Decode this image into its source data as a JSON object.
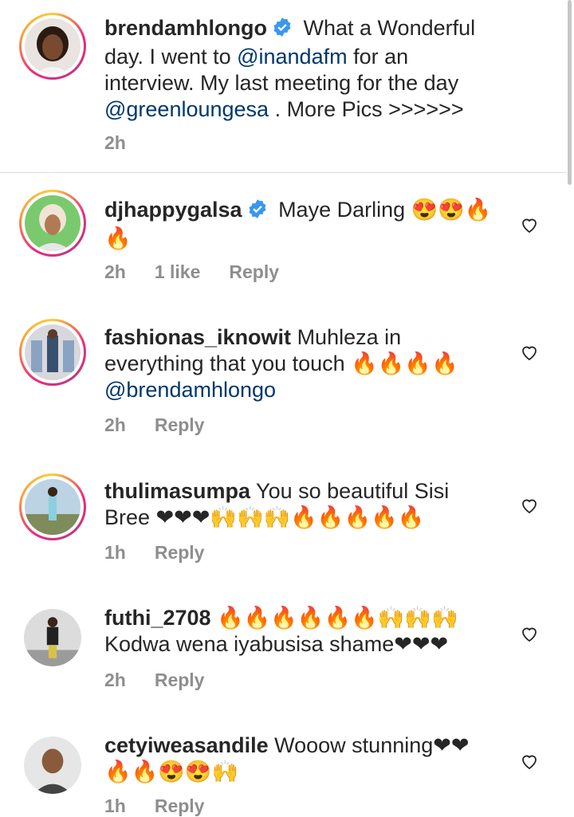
{
  "caption": {
    "username": "brendamhlongo",
    "verified": true,
    "text_start": "What a Wonderful",
    "line2_a": "day. I went to ",
    "mention1": "@inandafm",
    "line2_b": " for an",
    "line3": "interview. My last meeting for the day",
    "mention2": "@greenloungesa",
    "line4_b": " . More Pics >>>>>>",
    "time": "2h"
  },
  "comments": [
    {
      "username": "djhappygalsa",
      "verified": true,
      "line1": "Maye Darling 😍😍🔥",
      "line2": "🔥",
      "time": "2h",
      "likes": "1 like",
      "reply": "Reply"
    },
    {
      "username": "fashionas_iknowit",
      "line1": " Muhleza in",
      "line2": "everything that you touch 🔥🔥🔥🔥",
      "mention": "@brendamhlongo",
      "time": "2h",
      "reply": "Reply"
    },
    {
      "username": "thulimasumpa",
      "line1": " You so beautiful Sisi",
      "line2": "Bree ❤❤❤🙌🙌🙌🔥🔥🔥🔥🔥",
      "time": "1h",
      "reply": "Reply"
    },
    {
      "username": "futhi_2708",
      "line1": " 🔥🔥🔥🔥🔥🔥🙌🙌🙌",
      "line2": "Kodwa wena iyabusisa shame❤❤❤",
      "time": "2h",
      "reply": "Reply"
    },
    {
      "username": "cetyiweasandile",
      "line1": " Wooow stunning❤❤",
      "line2": "🔥🔥😍😍🙌",
      "time": "1h",
      "reply": "Reply"
    }
  ],
  "colors": {
    "text": "#262626",
    "mention": "#00376b",
    "meta": "#8e8e8e",
    "verified": "#3897f0"
  }
}
